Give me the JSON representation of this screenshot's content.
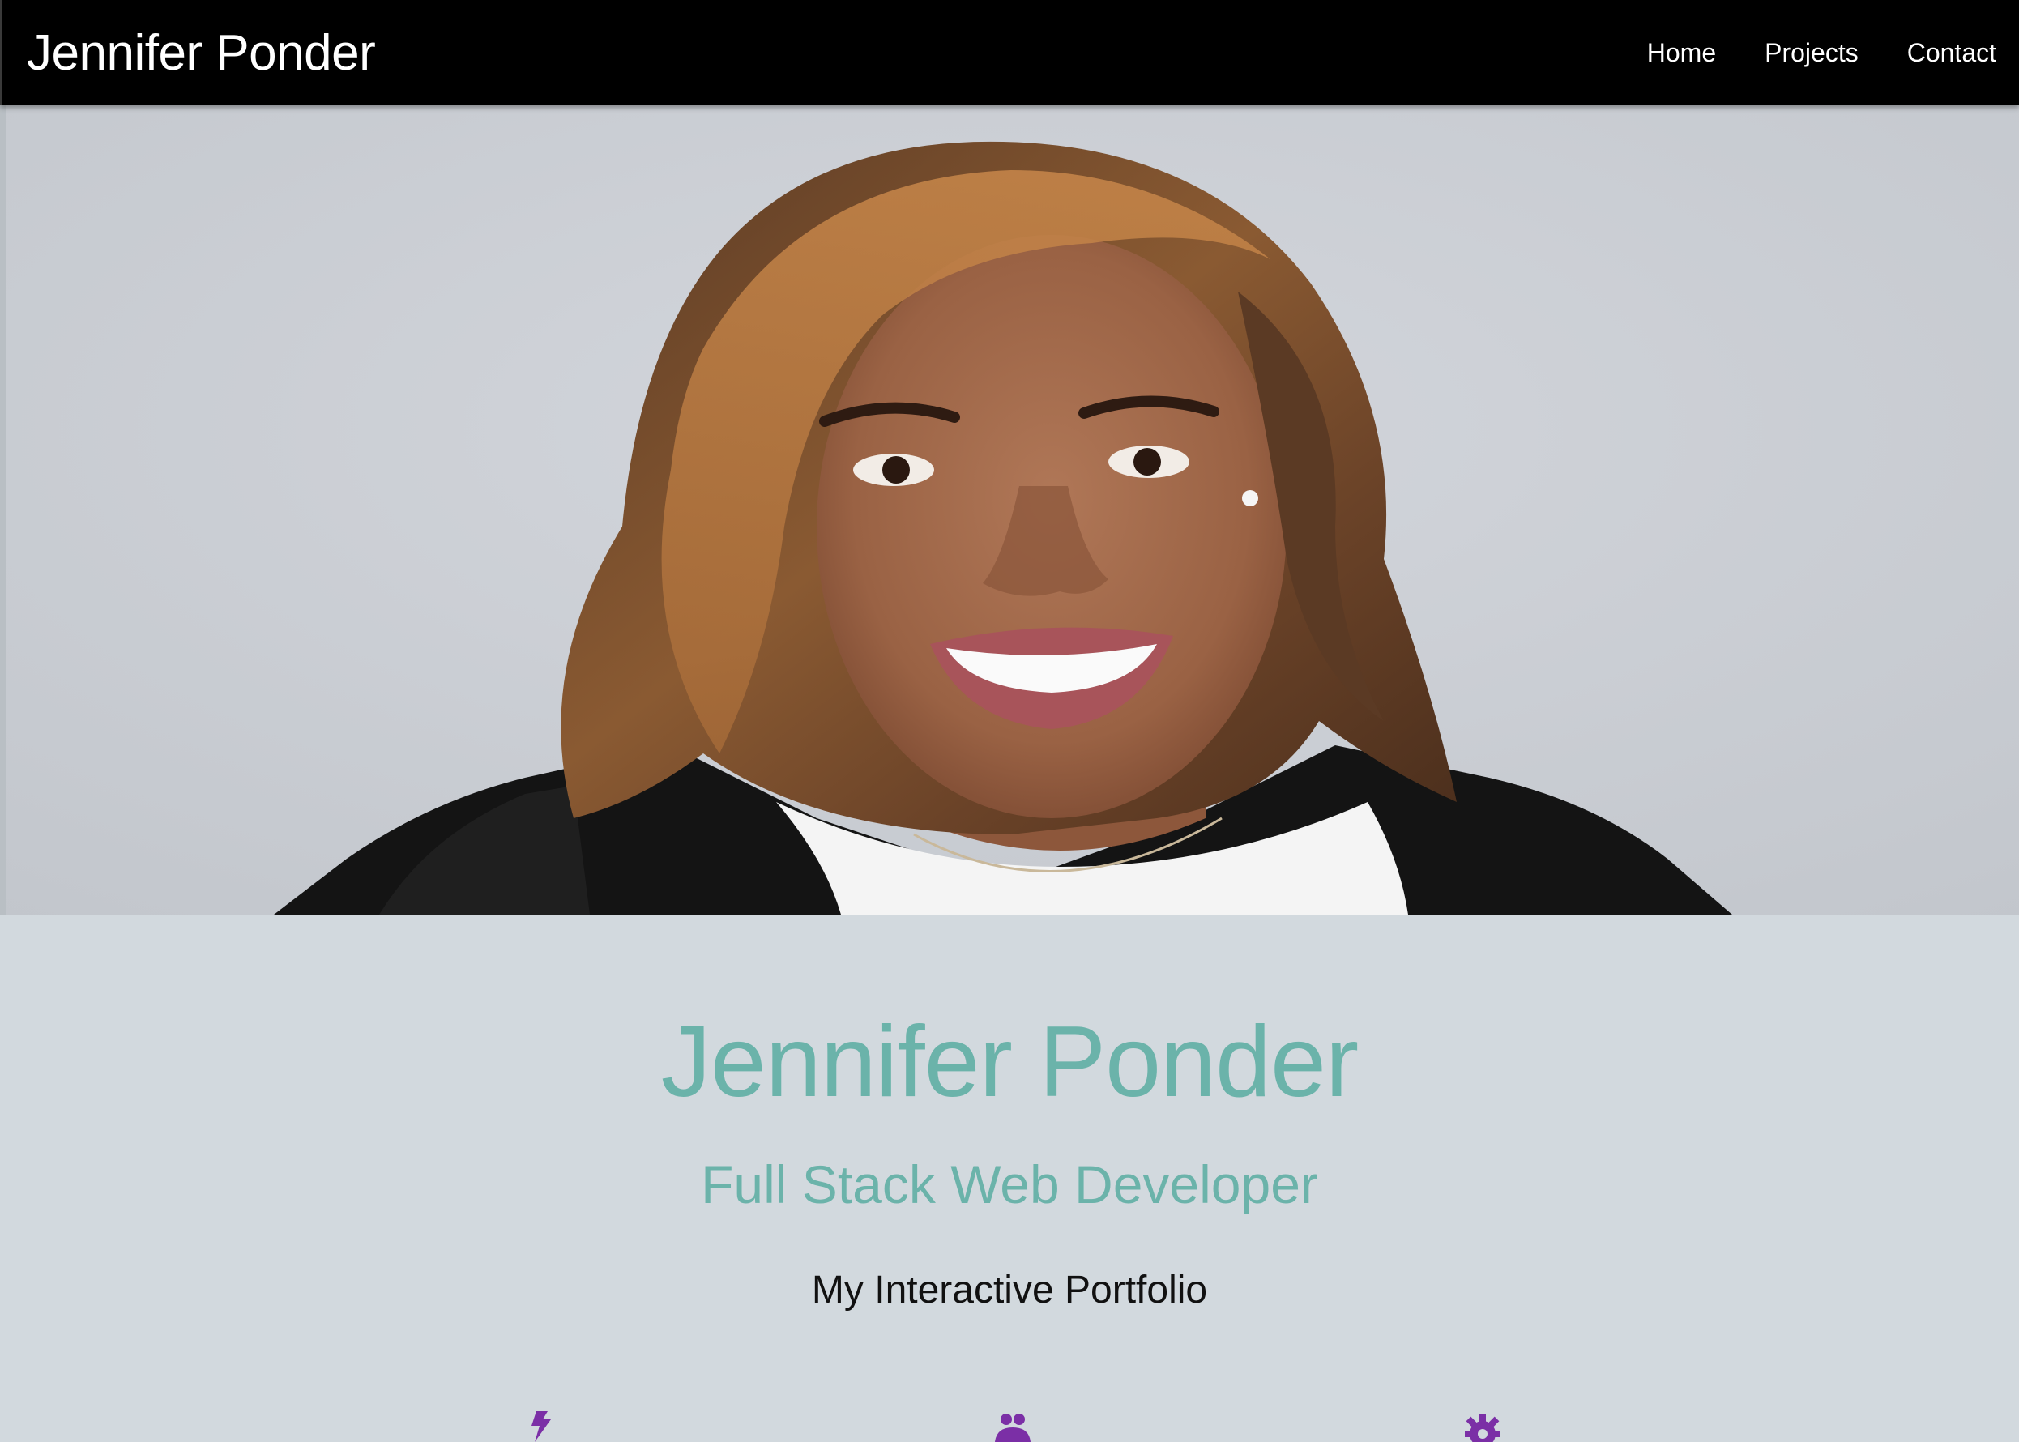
{
  "navbar": {
    "brand": "Jennifer Ponder",
    "links": [
      {
        "label": "Home"
      },
      {
        "label": "Projects"
      },
      {
        "label": "Contact"
      }
    ]
  },
  "hero": {
    "image_alt": "Portrait of Jennifer Ponder"
  },
  "intro": {
    "name": "Jennifer Ponder",
    "role": "Full Stack Web Developer",
    "tagline": "My Interactive Portfolio"
  },
  "features": [
    {
      "icon": "bolt-icon"
    },
    {
      "icon": "users-icon"
    },
    {
      "icon": "gear-icon"
    }
  ],
  "colors": {
    "navbar_bg": "#000000",
    "page_bg": "#d2d9de",
    "accent_teal": "#6bb3aa",
    "icon_purple": "#7b2fa6"
  }
}
